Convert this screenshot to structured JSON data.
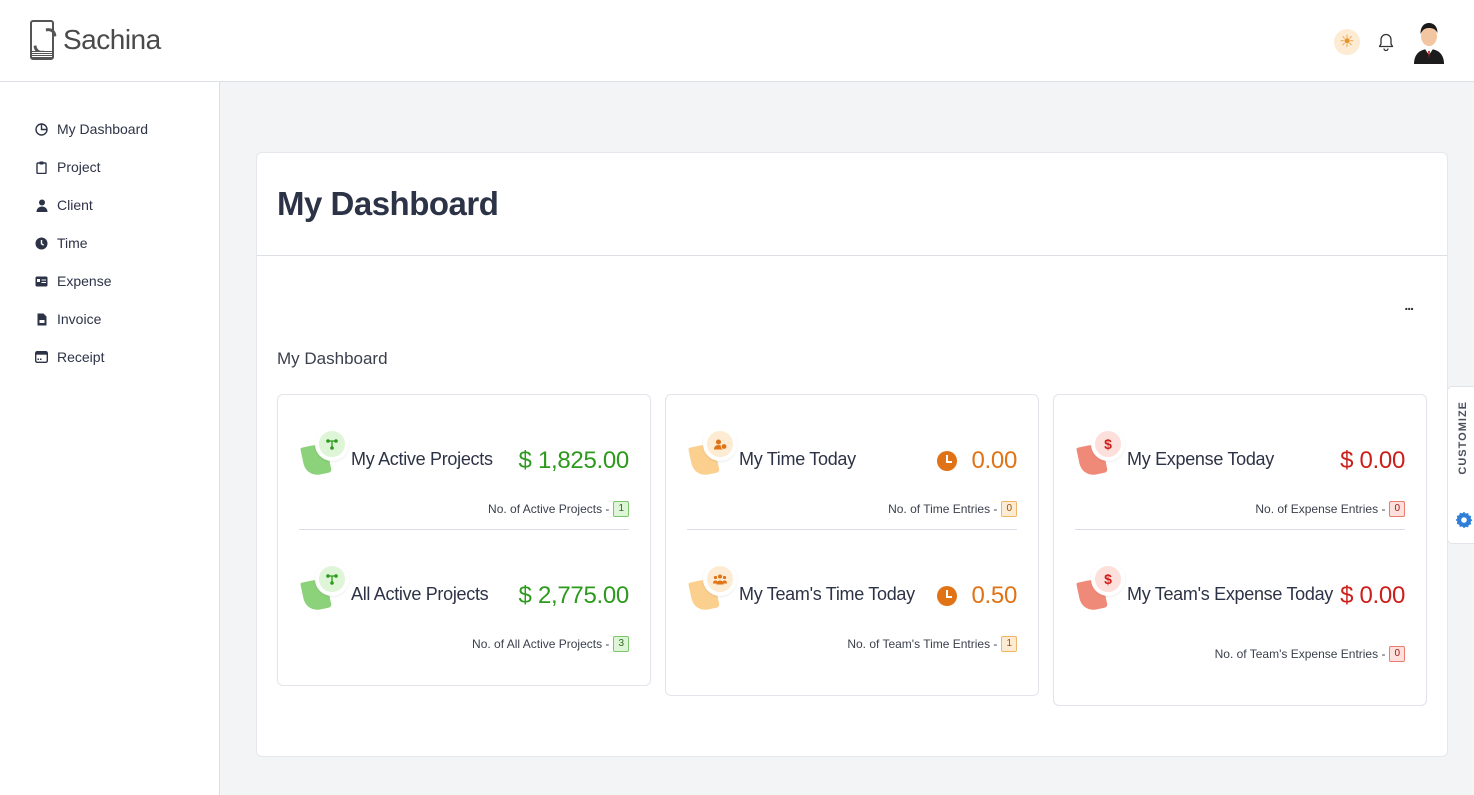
{
  "app": {
    "name": "Sachina"
  },
  "header": {
    "icons": [
      "sun-icon",
      "bell-icon",
      "avatar"
    ]
  },
  "sidebar": {
    "items": [
      {
        "label": "My Dashboard",
        "icon": "pie-chart-icon"
      },
      {
        "label": "Project",
        "icon": "clipboard-icon"
      },
      {
        "label": "Client",
        "icon": "user-icon"
      },
      {
        "label": "Time",
        "icon": "clock-icon"
      },
      {
        "label": "Expense",
        "icon": "id-card-icon"
      },
      {
        "label": "Invoice",
        "icon": "file-invoice-icon"
      },
      {
        "label": "Receipt",
        "icon": "receipt-icon"
      }
    ]
  },
  "main": {
    "title": "My Dashboard",
    "more_label": "...",
    "section_title": "My Dashboard",
    "cards": [
      {
        "accent": "#2c9a1c",
        "items": [
          {
            "label": "My Active Projects",
            "value": "$ 1,825.00",
            "sub_label": "No. of Active Projects -",
            "count": "1"
          },
          {
            "label": "All Active Projects",
            "value": "$ 2,775.00",
            "sub_label": "No. of All Active Projects -",
            "count": "3"
          }
        ]
      },
      {
        "accent": "#e07316",
        "items": [
          {
            "label": "My Time Today",
            "value": "0.00",
            "sub_label": "No. of Time Entries -",
            "count": "0"
          },
          {
            "label": "My Team's Time Today",
            "value": "0.50",
            "sub_label": "No. of Team's Time Entries -",
            "count": "1"
          }
        ]
      },
      {
        "accent": "#cc1f1a",
        "items": [
          {
            "label": "My Expense Today",
            "value": "$ 0.00",
            "sub_label": "No. of Expense Entries -",
            "count": "0"
          },
          {
            "label": "My Team's Expense Today",
            "value": "$ 0.00",
            "sub_label": "No. of Team's Expense Entries -",
            "count": "0"
          }
        ]
      }
    ]
  },
  "customize": {
    "label": "CUSTOMIZE",
    "icon": "gear-icon"
  }
}
